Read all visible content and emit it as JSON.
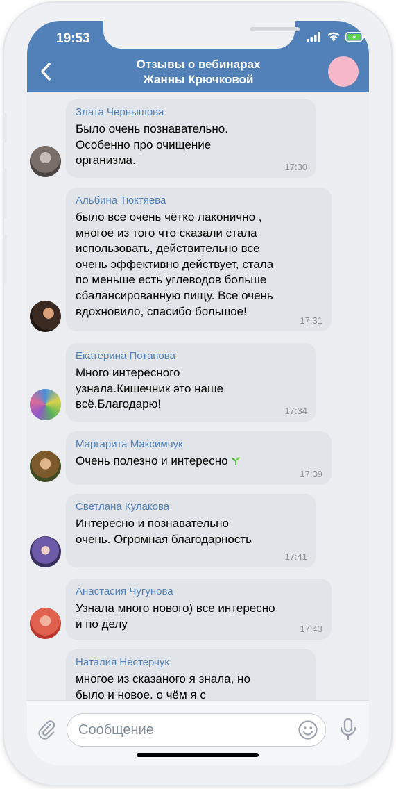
{
  "status": {
    "time": "19:53"
  },
  "header": {
    "title_line1": "Отзывы о вебинарах",
    "title_line2": "Жанны Крючковой"
  },
  "messages": [
    {
      "name": "Злата Чернышова",
      "text": "Было очень познавательно.\nОсобенно про очищение\nорганизма.",
      "time": "17:30"
    },
    {
      "name": "Альбина Тюктяева",
      "text": "было все очень чётко лаконично ,\nмногое из того что сказали стала\nиспользовать, действительно все\nочень эффективно действует, стала\nпо меньше есть углеводов больше\nсбалансированную пищу. Все очень\nвдохновило, спасибо большое!",
      "time": "17:31"
    },
    {
      "name": "Екатерина Потапова",
      "text": "Много интересного\nузнала.Кишечник это наше\nвсё.Благодарю!",
      "time": "17:34"
    },
    {
      "name": "Маргарита Максимчук",
      "text": "Очень полезно и интересно",
      "time": "17:39",
      "emoji": "sprout-icon"
    },
    {
      "name": "Светлана Кулакова",
      "text": "Интересно и познавательно\nочень. Огромная благодарность",
      "time": "17:41"
    },
    {
      "name": "Анастасия Чугунова",
      "text": "Узнала много нового) все интересно\nи по делу",
      "time": "17:43"
    },
    {
      "name": "Наталия Нестерчук",
      "text": "многое из сказаного я знала, но\nбыло и новое. о чём я с",
      "time": ""
    }
  ],
  "input": {
    "placeholder": "Сообщение"
  },
  "colors": {
    "header": "#5181b8",
    "bubble": "#e1e4e8",
    "name": "#5181b8",
    "background": "#ebedf0"
  }
}
